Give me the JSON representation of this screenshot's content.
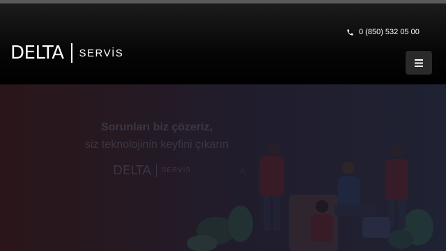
{
  "brand": {
    "name": "DELTA",
    "subtitle": "SERVİS"
  },
  "header": {
    "phone": "0 (850) 532 05 00"
  },
  "hero": {
    "line1": "Sorunları biz çözeriz,",
    "line2": "siz teknolojinin keyfini çıkarın",
    "logo_name": "DELTA",
    "logo_subtitle": "SERVİS"
  },
  "colors": {
    "accent": "#e3193f",
    "header_bg": "#000000",
    "menu_button": "#2a2a2a"
  },
  "icons": {
    "phone": "phone-icon",
    "menu": "hamburger-menu-icon"
  }
}
